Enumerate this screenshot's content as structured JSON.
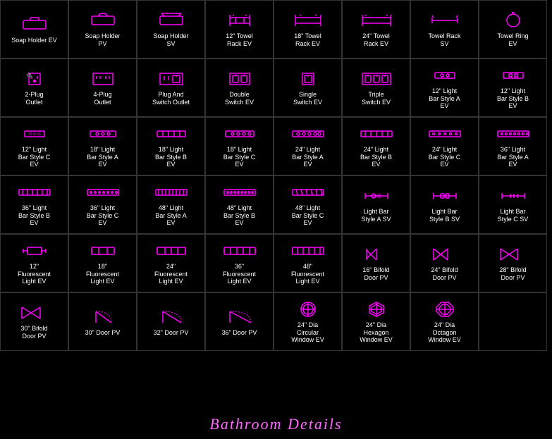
{
  "title": "Bathroom Details",
  "items": [
    {
      "id": "soap-holder-ev",
      "label": "Soap Holder\nEV",
      "row": 1,
      "col": 1,
      "icon": "soap-holder"
    },
    {
      "id": "soap-holder-pv",
      "label": "Soap Holder\nPV",
      "row": 1,
      "col": 2,
      "icon": "soap-holder-pv"
    },
    {
      "id": "soap-holder-sv",
      "label": "Soap Holder\nSV",
      "row": 1,
      "col": 3,
      "icon": "soap-holder-sv"
    },
    {
      "id": "12-towel-rack-ev",
      "label": "12\" Towel\nRack EV",
      "row": 1,
      "col": 4,
      "icon": "towel-rack-12"
    },
    {
      "id": "18-towel-rack-ev",
      "label": "18\" Towel\nRack EV",
      "row": 1,
      "col": 5,
      "icon": "towel-rack-18"
    },
    {
      "id": "24-towel-rack-ev",
      "label": "24\" Towel\nRack EV",
      "row": 1,
      "col": 6,
      "icon": "towel-rack-24"
    },
    {
      "id": "towel-rack-sv",
      "label": "Towel Rack\nSV",
      "row": 1,
      "col": 7,
      "icon": "towel-rack-sv"
    },
    {
      "id": "towel-ring-ev",
      "label": "Towel Ring\nEV",
      "row": 1,
      "col": 8,
      "icon": "towel-ring"
    },
    {
      "id": "2-plug-outlet",
      "label": "2-Plug\nOutlet",
      "row": 2,
      "col": 1,
      "icon": "outlet-2"
    },
    {
      "id": "4-plug-outlet",
      "label": "4-Plug\nOutlet",
      "row": 2,
      "col": 2,
      "icon": "outlet-4"
    },
    {
      "id": "plug-switch-outlet",
      "label": "Plug And\nSwitch Outlet",
      "row": 2,
      "col": 3,
      "icon": "plug-switch"
    },
    {
      "id": "double-switch-ev",
      "label": "Double\nSwitch EV",
      "row": 2,
      "col": 4,
      "icon": "switch-double"
    },
    {
      "id": "single-switch-ev",
      "label": "Single\nSwitch EV",
      "row": 2,
      "col": 5,
      "icon": "switch-single"
    },
    {
      "id": "triple-switch-ev",
      "label": "Triple\nSwitch EV",
      "row": 2,
      "col": 6,
      "icon": "switch-triple"
    },
    {
      "id": "12-light-bar-a-ev",
      "label": "12\" Light\nBar Style A\nEV",
      "row": 2,
      "col": 7,
      "icon": "light-bar-12a"
    },
    {
      "id": "12-light-bar-b-ev",
      "label": "12\" Light\nBar Style B\nEV",
      "row": 2,
      "col": 8,
      "icon": "light-bar-12b"
    },
    {
      "id": "12-light-bar-c-ev",
      "label": "12\" Light\nBar Style C\nEV",
      "row": 3,
      "col": 1,
      "icon": "light-bar-12c"
    },
    {
      "id": "18-light-bar-a-ev",
      "label": "18\" Light\nBar Style A\nEV",
      "row": 3,
      "col": 2,
      "icon": "light-bar-18a"
    },
    {
      "id": "18-light-bar-b-ev",
      "label": "18\" Light\nBar Style B\nEV",
      "row": 3,
      "col": 3,
      "icon": "light-bar-18b"
    },
    {
      "id": "18-light-bar-c-ev",
      "label": "18\" Light\nBar Style C\nEV",
      "row": 3,
      "col": 4,
      "icon": "light-bar-18c"
    },
    {
      "id": "24-light-bar-a-ev",
      "label": "24\" Light\nBar Style A\nEV",
      "row": 3,
      "col": 5,
      "icon": "light-bar-24a"
    },
    {
      "id": "24-light-bar-b-ev",
      "label": "24\" Light\nBar Style B\nEV",
      "row": 3,
      "col": 6,
      "icon": "light-bar-24b"
    },
    {
      "id": "24-light-bar-c-ev",
      "label": "24\" Light\nBar Style C\nEV",
      "row": 3,
      "col": 7,
      "icon": "light-bar-24c"
    },
    {
      "id": "36-light-bar-a-ev",
      "label": "36\" Light\nBar Style A\nEV",
      "row": 3,
      "col": 8,
      "icon": "light-bar-36a"
    },
    {
      "id": "36-light-bar-b-ev",
      "label": "36\" Light\nBar Style B\nEV",
      "row": 4,
      "col": 1,
      "icon": "light-bar-36b"
    },
    {
      "id": "36-light-bar-c-ev",
      "label": "36\" Light\nBar Style C\nEV",
      "row": 4,
      "col": 2,
      "icon": "light-bar-36c"
    },
    {
      "id": "48-light-bar-a-ev",
      "label": "48\" Light\nBar Style A\nEV",
      "row": 4,
      "col": 3,
      "icon": "light-bar-48a"
    },
    {
      "id": "48-light-bar-b-ev",
      "label": "48\" Light\nBar Style B\nEV",
      "row": 4,
      "col": 4,
      "icon": "light-bar-48b"
    },
    {
      "id": "48-light-bar-c-ev",
      "label": "48\" Light\nBar Style C\nEV",
      "row": 4,
      "col": 5,
      "icon": "light-bar-48c"
    },
    {
      "id": "light-bar-a-sv",
      "label": "Light Bar\nStyle A SV",
      "row": 4,
      "col": 6,
      "icon": "light-bar-a-sv"
    },
    {
      "id": "light-bar-b-sv",
      "label": "Light Bar\nStyle B SV",
      "row": 4,
      "col": 7,
      "icon": "light-bar-b-sv"
    },
    {
      "id": "light-bar-c-sv",
      "label": "Light Bar\nStyle C SV",
      "row": 4,
      "col": 8,
      "icon": "light-bar-c-sv"
    },
    {
      "id": "12-fluor-ev",
      "label": "12\"\nFluorescent\nLight EV",
      "row": 5,
      "col": 1,
      "icon": "fluor-12"
    },
    {
      "id": "18-fluor-ev",
      "label": "18\"\nFluorescent\nLight EV",
      "row": 5,
      "col": 2,
      "icon": "fluor-18"
    },
    {
      "id": "24-fluor-ev",
      "label": "24\"\nFluorescent\nLight EV",
      "row": 5,
      "col": 3,
      "icon": "fluor-24"
    },
    {
      "id": "36-fluor-ev",
      "label": "36\"\nFluorescent\nLight EV",
      "row": 5,
      "col": 4,
      "icon": "fluor-36"
    },
    {
      "id": "48-fluor-ev",
      "label": "48\"\nFluorescent\nLight EV",
      "row": 5,
      "col": 5,
      "icon": "fluor-48"
    },
    {
      "id": "16-bifold-pv",
      "label": "16\" Bifold\nDoor PV",
      "row": 5,
      "col": 6,
      "icon": "bifold-16"
    },
    {
      "id": "24-bifold-pv",
      "label": "24\" Bifold\nDoor PV",
      "row": 5,
      "col": 7,
      "icon": "bifold-24"
    },
    {
      "id": "28-bifold-pv",
      "label": "28\" Bifold\nDoor PV",
      "row": 5,
      "col": 8,
      "icon": "bifold-28"
    },
    {
      "id": "30-bifold-pv",
      "label": "30\" Bifold\nDoor PV",
      "row": 6,
      "col": 1,
      "icon": "bifold-30"
    },
    {
      "id": "30-door-pv",
      "label": "30\" Door PV",
      "row": 6,
      "col": 2,
      "icon": "door-30"
    },
    {
      "id": "32-door-pv",
      "label": "32\" Door PV",
      "row": 6,
      "col": 3,
      "icon": "door-32"
    },
    {
      "id": "36-door-pv",
      "label": "36\" Door PV",
      "row": 6,
      "col": 4,
      "icon": "door-36"
    },
    {
      "id": "24-circular-ev",
      "label": "24\" Dia\nCircular\nWindow EV",
      "row": 6,
      "col": 5,
      "icon": "window-circular"
    },
    {
      "id": "24-hexagon-ev",
      "label": "24\" Dia\nHexagon\nWindow EV",
      "row": 6,
      "col": 6,
      "icon": "window-hexagon"
    },
    {
      "id": "24-octagon-ev",
      "label": "24\" Dia\nOctagon\nWindow EV",
      "row": 6,
      "col": 7,
      "icon": "window-octagon"
    }
  ],
  "footer": "Bathroom  Details",
  "accent_color": "#ff00ff",
  "footer_color": "#ff88ff"
}
